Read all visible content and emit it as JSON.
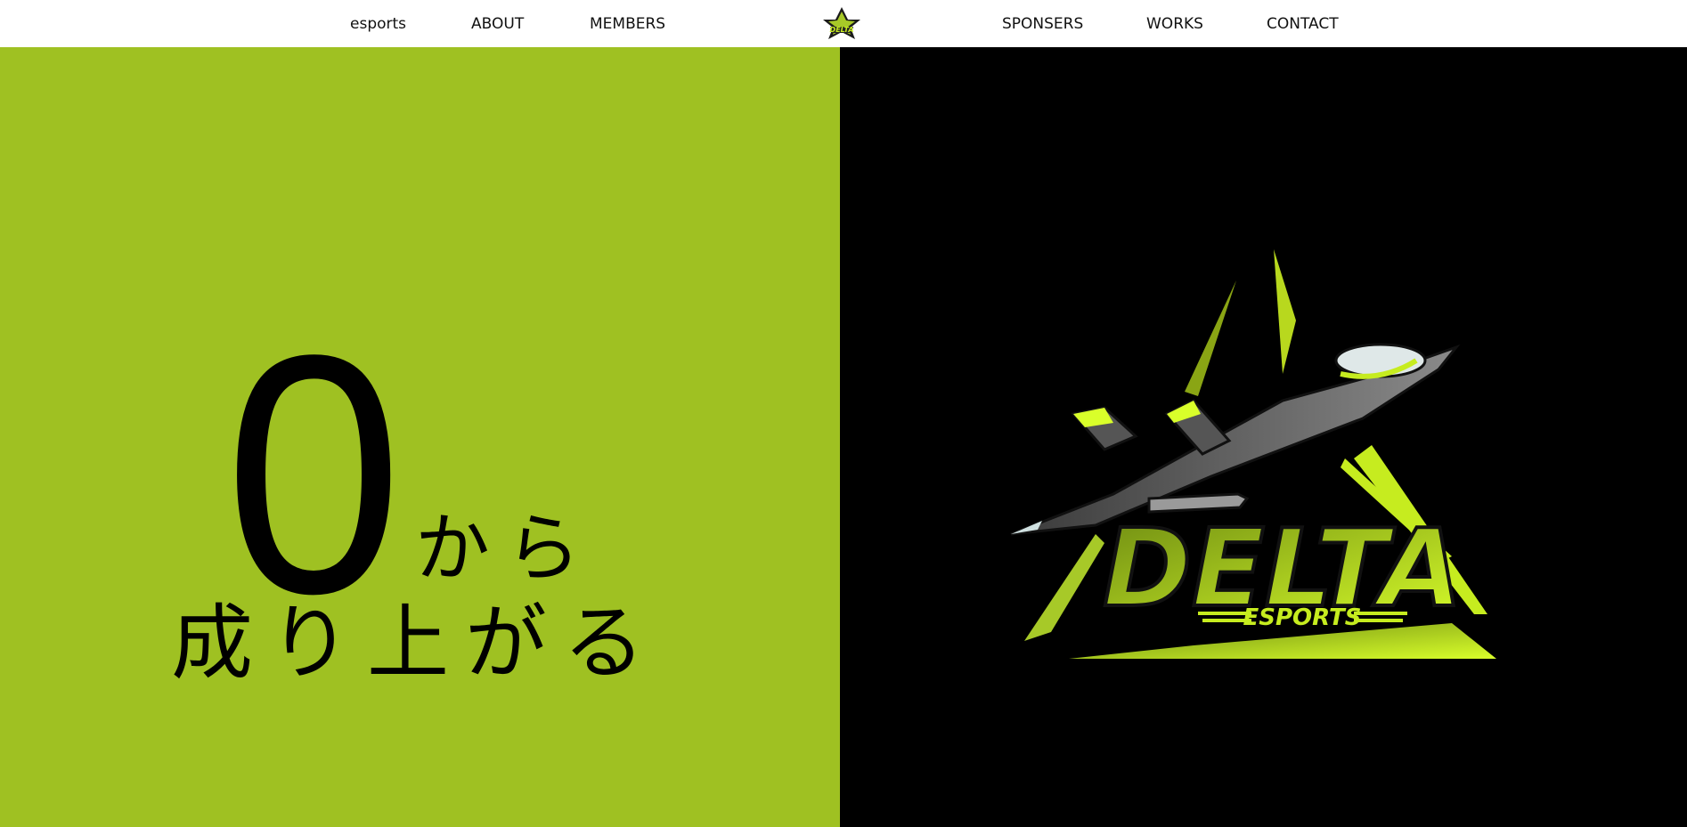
{
  "nav": {
    "left": [
      {
        "label": "esports"
      },
      {
        "label": "ABOUT"
      },
      {
        "label": "MEMBERS"
      }
    ],
    "right": [
      {
        "label": "SPONSERS"
      },
      {
        "label": "WORKS"
      },
      {
        "label": "CONTACT"
      }
    ],
    "logo_icon": "delta-star-logo-icon"
  },
  "hero": {
    "tagline_number": "0",
    "tagline_kara": "から",
    "tagline_line2": "成り上がる",
    "emblem_icon": "delta-esports-fighter-jet-emblem",
    "emblem_title": "DELTA",
    "emblem_subtitle": "ESPORTS"
  },
  "colors": {
    "accent": "#9fc122",
    "hero_right_bg": "#000000",
    "header_bg": "#ffffff",
    "text": "#111111",
    "emblem_lime": "#c6ec1f"
  }
}
